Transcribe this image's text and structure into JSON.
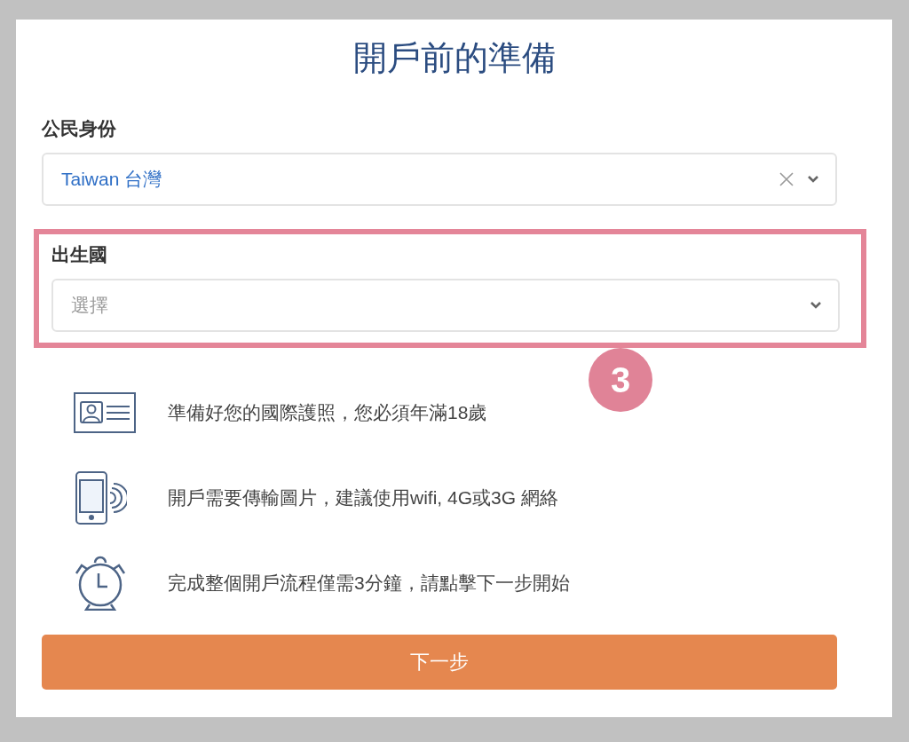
{
  "title": "開戶前的準備",
  "fields": [
    {
      "label": "公民身份",
      "value": "Taiwan 台灣",
      "clearable": true,
      "highlighted": false
    },
    {
      "label": "出生國",
      "placeholder": "選擇",
      "clearable": false,
      "highlighted": true
    }
  ],
  "step_badge": "3",
  "notes": [
    {
      "kind": "id-card",
      "text": "準備好您的國際護照，您必須年滿18歲"
    },
    {
      "kind": "phone",
      "text": "開戶需要傳輸圖片，建議使用wifi, 4G或3G 網絡"
    },
    {
      "kind": "clock",
      "text": "完成整個開戶流程僅需3分鐘，請點擊下一步開始"
    }
  ],
  "button": "下一步"
}
